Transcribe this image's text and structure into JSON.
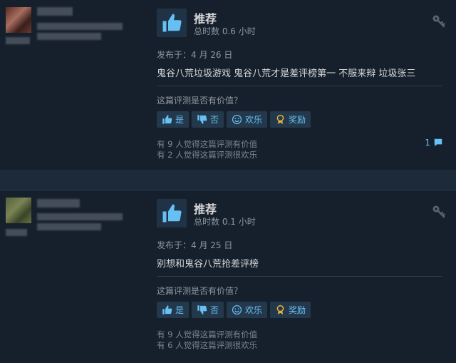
{
  "reviews": [
    {
      "verdict": "推荐",
      "hours": "总时数 0.6 小时",
      "posted": "发布于：4 月 26 日",
      "content": "鬼谷八荒垃圾游戏 鬼谷八荒才是差评榜第一 不服来辩 垃圾张三",
      "question": "这篇评测是否有价值？",
      "buttons": {
        "yes": "是",
        "no": "否",
        "funny": "欢乐",
        "award": "奖励"
      },
      "helpful": "有 9 人觉得这篇评测有价值",
      "funny_count": "有 2 人觉得这篇评测很欢乐",
      "comments": "1"
    },
    {
      "verdict": "推荐",
      "hours": "总时数 0.1 小时",
      "posted": "发布于：4 月 25 日",
      "content": "别想和鬼谷八荒抢差评榜",
      "question": "这篇评测是否有价值？",
      "buttons": {
        "yes": "是",
        "no": "否",
        "funny": "欢乐",
        "award": "奖励"
      },
      "helpful": "有 9 人觉得这篇评测有价值",
      "funny_count": "有 6 人觉得这篇评测很欢乐"
    }
  ],
  "icons": {
    "recommend": "thumbs-up-icon",
    "key": "key-icon",
    "comment": "comment-icon"
  },
  "colors": {
    "accent": "#67c1f5",
    "background": "#1b2838",
    "panel": "#16202d"
  }
}
